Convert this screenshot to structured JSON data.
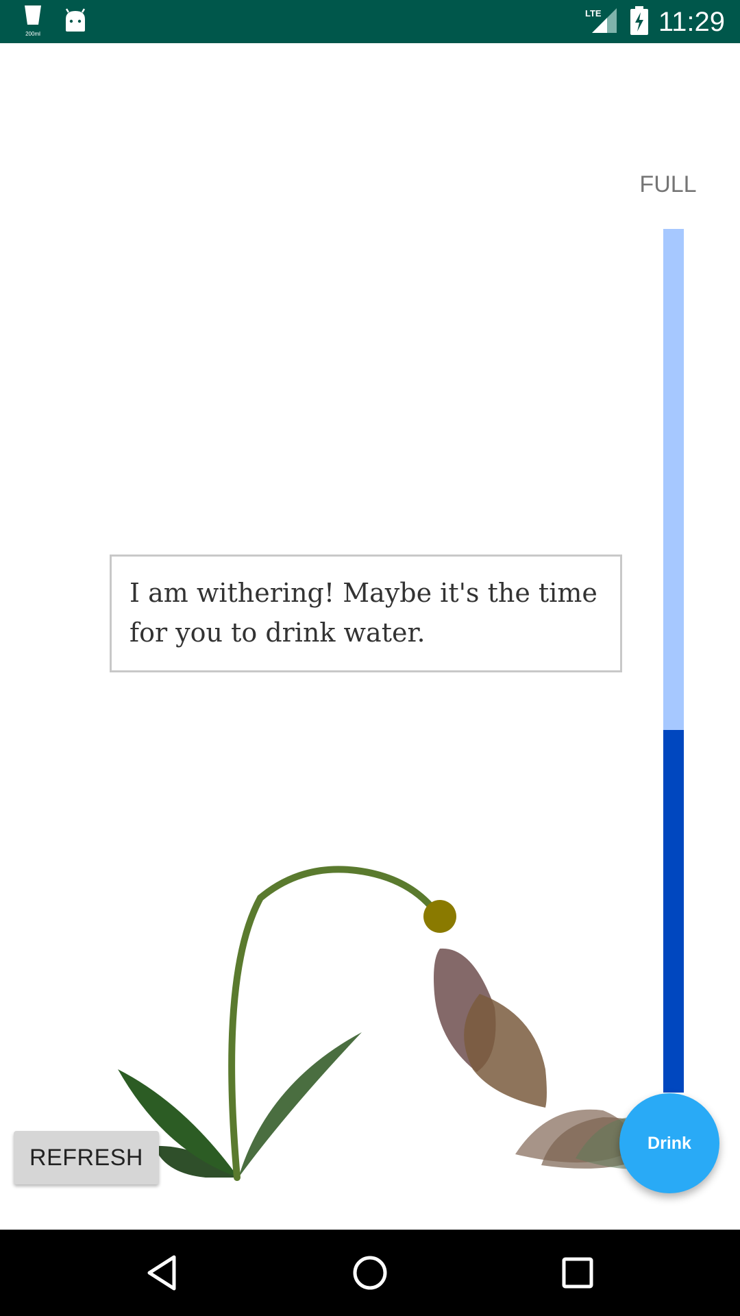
{
  "status_bar": {
    "time": "11:29",
    "cup_label": "200ml",
    "network": "LTE",
    "background_color": "#00574b",
    "icons": [
      "cup-icon",
      "android-icon",
      "lte-signal-icon",
      "battery-charging-icon"
    ]
  },
  "water_level": {
    "label": "FULL",
    "fraction": 0.42,
    "track_color": "#a6c8ff",
    "fill_color": "#0047bf"
  },
  "message": {
    "text": "I am withering! Maybe it's the time for you to drink water."
  },
  "buttons": {
    "refresh_label": "REFRESH",
    "drink_label": "Drink",
    "drink_color": "#29aaf6"
  },
  "navigation": {
    "icons": [
      "back-icon",
      "home-icon",
      "recents-icon"
    ]
  }
}
